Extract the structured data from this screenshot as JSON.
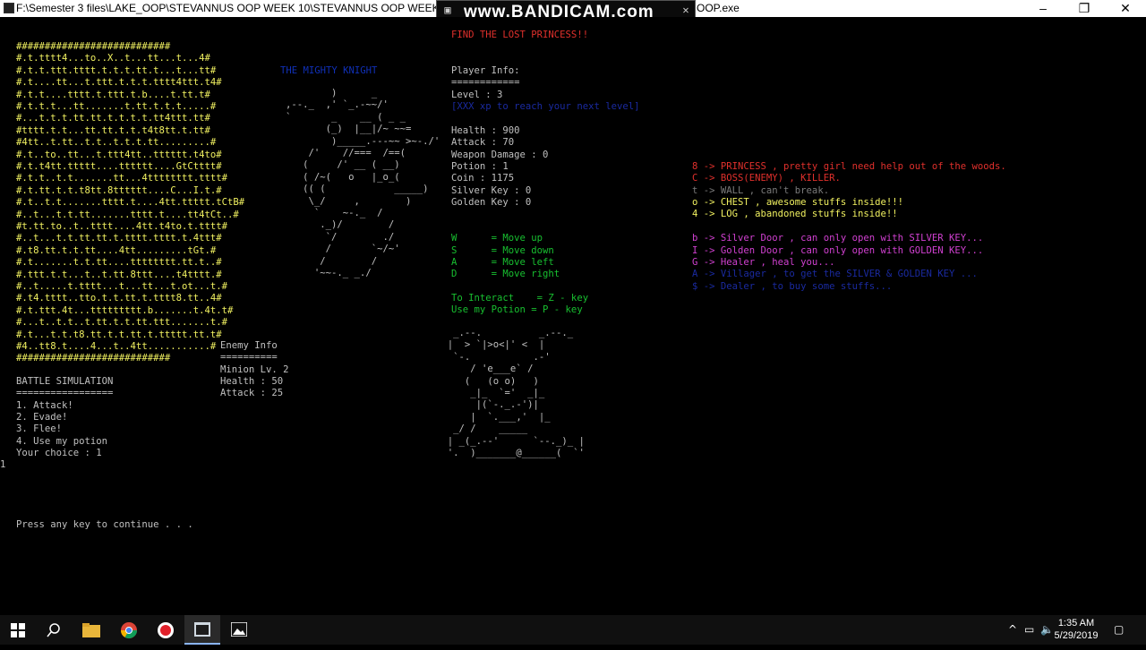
{
  "window": {
    "title": "F:\\Semester 3 files\\LAKE_OOP\\STEVANNUS OOP WEEK 10\\STEVANNUS OOP WEEK 10\\0122913_Stevannus",
    "title_tail": "OOP.exe",
    "minimize": "–",
    "maximize": "❐",
    "close": "✕"
  },
  "bandicam": {
    "logo": "www.BANDICAM.com"
  },
  "game": {
    "heading": "FIND THE LOST PRINCESS!!",
    "knight_title": "THE MIGHTY KNIGHT",
    "map_lines": [
      "###########################",
      "#.t.tttt4...to..X..t...tt...t...4#",
      "#.t.t.ttt.tttt.t.t.t.tt.t...t...tt#",
      "#.t....tt...t.ttt.t.t.t.tttt4ttt.t4#",
      "#.t.t....tttt.t.ttt.t.b....t.tt.t#",
      "#.t.t.t...tt.......t.tt.t.t.t.....#",
      "#...t.t.t.tt.tt.t.t.t.t.tt4ttt.tt#",
      "#tttt.t.t...tt.tt.t.t.t4t8tt.t.tt#",
      "#4tt..t.tt..t.t..t.t.t.tt.........#",
      "#.t..to..tt...t.ttt4tt..tttttt.t4to#",
      "#.t.t4tt.ttttt....tttttt....GtCtttt#",
      "#.t.t..t.t.......tt...4tttttttt.tttt#",
      "#.t.tt.t.t.t8tt.8tttttt....C...I.t.#",
      "#.t..t.t.......tttt.t....4tt.ttttt.tCtB#",
      "#..t...t.t.tt.......tttt.t....tt4tCt..#",
      "#t.tt.to..t..tttt....4tt.t4to.t.tttt#",
      "#..t...t.t.tt.tt.t.tttt.tttt.t.4ttt#",
      "#.t8.tt.t.t.tt....4tt.........tGt.#",
      "#.t.......t.t.tt....tttttttt.tt.t..#",
      "#.ttt.t.t...t..t.tt.8ttt....t4tttt.#",
      "#..t.....t.tttt...t...tt...t.ot...t.#",
      "#.t4.tttt..tto.t.t.tt.t.tttt8.tt..4#",
      "#.t.ttt.4t...ttttttttt.b.......t.4t.t#",
      "#...t..t.t..t.tt.t.t.tt.ttt.......t.#",
      "#.t...t.t.t8.tt.t.t.tt.t.ttttt.tt.t#",
      "#4..tt8.t....4...t..4tt...........#",
      "###########################"
    ],
    "knight_art": [
      "                )      _",
      "        ,--._  ,' `_.-~~/'",
      "        `       _    __ ( _ _",
      "               (_)  |__|/~ ~~=",
      "                )_____.---~~ >~-./'",
      "            /'    //===  /==(",
      "           (     /' __ ( __)",
      "           ( /~(   o   |_o_(",
      "           (( (            _____)",
      "            \\_/     ,        )",
      "             `    ~-._  /",
      "              ._)/        /",
      "               `/        ./",
      "               /       `~/~'",
      "              /        /",
      "             '~~-._ _./"
    ],
    "player": {
      "heading": "Player Info:",
      "divider": "============",
      "level": "Level : 3",
      "hint": "[XXX xp to reach your next level]",
      "health": "Health : 900",
      "attack": "Attack : 70",
      "weapon": "Weapon Damage : 0",
      "potion": "Potion : 1",
      "coin": "Coin : 1175",
      "silver_key": "Silver Key : 0",
      "golden_key": "Golden Key : 0"
    },
    "controls": [
      "W      = Move up",
      "S      = Move down",
      "A      = Move left",
      "D      = Move right"
    ],
    "interact": "To Interact    = Z - key",
    "use_potion": "Use my Potion = P - key",
    "legend": {
      "princess": "8 -> PRINCESS , pretty girl need help out of the woods.",
      "boss": "C -> BOSS(ENEMY) , KILLER.",
      "wall": "t -> WALL , can't break.",
      "chest": "o -> CHEST , awesome stuffs inside!!!",
      "log": "4 -> LOG , abandoned stuffs inside!!",
      "silver_door": "b -> Silver Door , can only open with SILVER KEY...",
      "golden_door": "I -> Golden Door , can only open with GOLDEN KEY...",
      "healer": "G -> Healer , heal you...",
      "villager": "A -> Villager , to get the SILVER & GOLDEN KEY ...",
      "dealer": "$ -> Dealer , to buy some stuffs..."
    },
    "enemy": {
      "heading": "Enemy Info",
      "divider": "==========",
      "name": "Minion Lv. 2",
      "health": "Health : 50",
      "attack": "Attack : 25"
    },
    "enemy_art": [
      "           _.--.          _.--._",
      "          |  > `|>o<|' <  |",
      "           `-.           .-'",
      "              / 'e___e` /",
      "             (   (o o)   )",
      "              _|_  `='  _|_",
      "               |(`-._.-')|",
      "              |  `.___,'  |_",
      "           _/ /    _____",
      "          | _(_.--'      `--._)_ |",
      "          '.  )_______@______(  `'"
    ],
    "battle": {
      "heading": "BATTLE SIMULATION",
      "divider": "=================",
      "options": [
        "1. Attack!",
        "2. Evade!",
        "3. Flee!",
        "4. Use my potion"
      ],
      "prompt": "Your choice : 1",
      "input_echo": "1",
      "continue": "Press any key to continue . . ."
    }
  },
  "taskbar": {
    "time": "1:35 AM",
    "date": "5/29/2019",
    "tray_chevron": "^"
  },
  "colors": {
    "console_bg": "#000000",
    "text": "#c0c0c0",
    "red": "#e0302c",
    "blue": "#1030b8",
    "yellow": "#f0f060",
    "magenta": "#d040d0",
    "green": "#18c030"
  }
}
